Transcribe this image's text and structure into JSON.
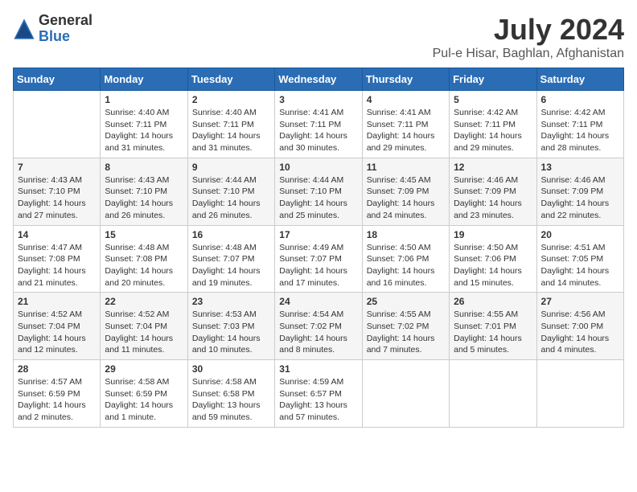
{
  "logo": {
    "general": "General",
    "blue": "Blue"
  },
  "title": "July 2024",
  "location": "Pul-e Hisar, Baghlan, Afghanistan",
  "weekdays": [
    "Sunday",
    "Monday",
    "Tuesday",
    "Wednesday",
    "Thursday",
    "Friday",
    "Saturday"
  ],
  "weeks": [
    {
      "shaded": false,
      "days": [
        {
          "num": "",
          "info": ""
        },
        {
          "num": "1",
          "info": "Sunrise: 4:40 AM\nSunset: 7:11 PM\nDaylight: 14 hours\nand 31 minutes."
        },
        {
          "num": "2",
          "info": "Sunrise: 4:40 AM\nSunset: 7:11 PM\nDaylight: 14 hours\nand 31 minutes."
        },
        {
          "num": "3",
          "info": "Sunrise: 4:41 AM\nSunset: 7:11 PM\nDaylight: 14 hours\nand 30 minutes."
        },
        {
          "num": "4",
          "info": "Sunrise: 4:41 AM\nSunset: 7:11 PM\nDaylight: 14 hours\nand 29 minutes."
        },
        {
          "num": "5",
          "info": "Sunrise: 4:42 AM\nSunset: 7:11 PM\nDaylight: 14 hours\nand 29 minutes."
        },
        {
          "num": "6",
          "info": "Sunrise: 4:42 AM\nSunset: 7:11 PM\nDaylight: 14 hours\nand 28 minutes."
        }
      ]
    },
    {
      "shaded": true,
      "days": [
        {
          "num": "7",
          "info": "Sunrise: 4:43 AM\nSunset: 7:10 PM\nDaylight: 14 hours\nand 27 minutes."
        },
        {
          "num": "8",
          "info": "Sunrise: 4:43 AM\nSunset: 7:10 PM\nDaylight: 14 hours\nand 26 minutes."
        },
        {
          "num": "9",
          "info": "Sunrise: 4:44 AM\nSunset: 7:10 PM\nDaylight: 14 hours\nand 26 minutes."
        },
        {
          "num": "10",
          "info": "Sunrise: 4:44 AM\nSunset: 7:10 PM\nDaylight: 14 hours\nand 25 minutes."
        },
        {
          "num": "11",
          "info": "Sunrise: 4:45 AM\nSunset: 7:09 PM\nDaylight: 14 hours\nand 24 minutes."
        },
        {
          "num": "12",
          "info": "Sunrise: 4:46 AM\nSunset: 7:09 PM\nDaylight: 14 hours\nand 23 minutes."
        },
        {
          "num": "13",
          "info": "Sunrise: 4:46 AM\nSunset: 7:09 PM\nDaylight: 14 hours\nand 22 minutes."
        }
      ]
    },
    {
      "shaded": false,
      "days": [
        {
          "num": "14",
          "info": "Sunrise: 4:47 AM\nSunset: 7:08 PM\nDaylight: 14 hours\nand 21 minutes."
        },
        {
          "num": "15",
          "info": "Sunrise: 4:48 AM\nSunset: 7:08 PM\nDaylight: 14 hours\nand 20 minutes."
        },
        {
          "num": "16",
          "info": "Sunrise: 4:48 AM\nSunset: 7:07 PM\nDaylight: 14 hours\nand 19 minutes."
        },
        {
          "num": "17",
          "info": "Sunrise: 4:49 AM\nSunset: 7:07 PM\nDaylight: 14 hours\nand 17 minutes."
        },
        {
          "num": "18",
          "info": "Sunrise: 4:50 AM\nSunset: 7:06 PM\nDaylight: 14 hours\nand 16 minutes."
        },
        {
          "num": "19",
          "info": "Sunrise: 4:50 AM\nSunset: 7:06 PM\nDaylight: 14 hours\nand 15 minutes."
        },
        {
          "num": "20",
          "info": "Sunrise: 4:51 AM\nSunset: 7:05 PM\nDaylight: 14 hours\nand 14 minutes."
        }
      ]
    },
    {
      "shaded": true,
      "days": [
        {
          "num": "21",
          "info": "Sunrise: 4:52 AM\nSunset: 7:04 PM\nDaylight: 14 hours\nand 12 minutes."
        },
        {
          "num": "22",
          "info": "Sunrise: 4:52 AM\nSunset: 7:04 PM\nDaylight: 14 hours\nand 11 minutes."
        },
        {
          "num": "23",
          "info": "Sunrise: 4:53 AM\nSunset: 7:03 PM\nDaylight: 14 hours\nand 10 minutes."
        },
        {
          "num": "24",
          "info": "Sunrise: 4:54 AM\nSunset: 7:02 PM\nDaylight: 14 hours\nand 8 minutes."
        },
        {
          "num": "25",
          "info": "Sunrise: 4:55 AM\nSunset: 7:02 PM\nDaylight: 14 hours\nand 7 minutes."
        },
        {
          "num": "26",
          "info": "Sunrise: 4:55 AM\nSunset: 7:01 PM\nDaylight: 14 hours\nand 5 minutes."
        },
        {
          "num": "27",
          "info": "Sunrise: 4:56 AM\nSunset: 7:00 PM\nDaylight: 14 hours\nand 4 minutes."
        }
      ]
    },
    {
      "shaded": false,
      "days": [
        {
          "num": "28",
          "info": "Sunrise: 4:57 AM\nSunset: 6:59 PM\nDaylight: 14 hours\nand 2 minutes."
        },
        {
          "num": "29",
          "info": "Sunrise: 4:58 AM\nSunset: 6:59 PM\nDaylight: 14 hours\nand 1 minute."
        },
        {
          "num": "30",
          "info": "Sunrise: 4:58 AM\nSunset: 6:58 PM\nDaylight: 13 hours\nand 59 minutes."
        },
        {
          "num": "31",
          "info": "Sunrise: 4:59 AM\nSunset: 6:57 PM\nDaylight: 13 hours\nand 57 minutes."
        },
        {
          "num": "",
          "info": ""
        },
        {
          "num": "",
          "info": ""
        },
        {
          "num": "",
          "info": ""
        }
      ]
    }
  ]
}
